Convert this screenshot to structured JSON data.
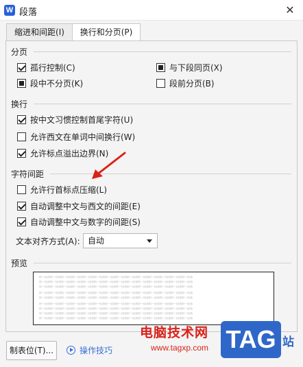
{
  "window": {
    "title": "段落",
    "app_icon_letter": "W"
  },
  "tabs": [
    {
      "label": "缩进和间距(I)",
      "active": false
    },
    {
      "label": "换行和分页(P)",
      "active": true
    }
  ],
  "pagination": {
    "heading": "分页",
    "options": [
      {
        "label": "孤行控制(C)",
        "state": "checked"
      },
      {
        "label": "与下段同页(X)",
        "state": "indeterminate"
      },
      {
        "label": "段中不分页(K)",
        "state": "indeterminate"
      },
      {
        "label": "段前分页(B)",
        "state": "unchecked"
      }
    ]
  },
  "line_break": {
    "heading": "换行",
    "options": [
      {
        "label": "按中文习惯控制首尾字符(U)",
        "state": "checked"
      },
      {
        "label": "允许西文在单词中间换行(W)",
        "state": "unchecked"
      },
      {
        "label": "允许标点溢出边界(N)",
        "state": "checked"
      }
    ]
  },
  "char_spacing": {
    "heading": "字符间距",
    "options": [
      {
        "label": "允许行首标点压缩(L)",
        "state": "unchecked"
      },
      {
        "label": "自动调整中文与西文的间距(E)",
        "state": "checked"
      },
      {
        "label": "自动调整中文与数字的间距(S)",
        "state": "checked"
      }
    ],
    "alignment_label": "文本对齐方式(A):",
    "alignment_value": "自动"
  },
  "preview": {
    "heading": "预览",
    "sample_text": "前一段落前一段落前一段落前一段落前一段落前一段落前一段落前一段落前一段落前一段落前一段落前一段落前一段落前一段落"
  },
  "footer": {
    "tabstop_label": "制表位(T)...",
    "tips_label": "操作技巧"
  },
  "watermark": {
    "site_name": "电脑技术网",
    "url": "www.tagxp.com",
    "tag": "TAG",
    "suffix": "站"
  },
  "colors": {
    "accent_blue": "#3a6fd6",
    "watermark_red": "#d9221a",
    "tag_blue": "#2f67c9",
    "arrow_red": "#d9221a"
  }
}
